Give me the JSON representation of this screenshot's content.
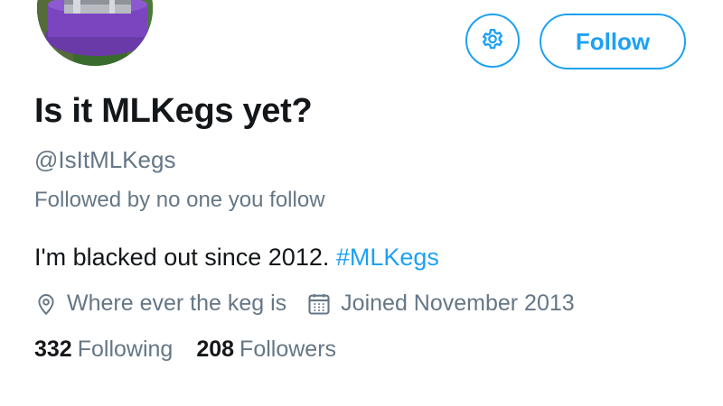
{
  "profile": {
    "display_name": "Is it MLKegs yet?",
    "handle": "@IsItMLKegs",
    "followed_by": "Followed by no one you follow",
    "bio_text": "I'm blacked out since 2012. ",
    "bio_hashtag": "#MLKegs",
    "location": "Where ever the keg is",
    "joined": "Joined November 2013",
    "following_count": "332",
    "following_label": "Following",
    "followers_count": "208",
    "followers_label": "Followers"
  },
  "actions": {
    "follow_label": "Follow",
    "settings_icon": "gear-icon"
  },
  "icons": {
    "location": "location-pin-icon",
    "joined": "calendar-icon"
  },
  "colors": {
    "accent": "#1da1f2",
    "text_primary": "#14171a",
    "text_secondary": "#657786"
  }
}
